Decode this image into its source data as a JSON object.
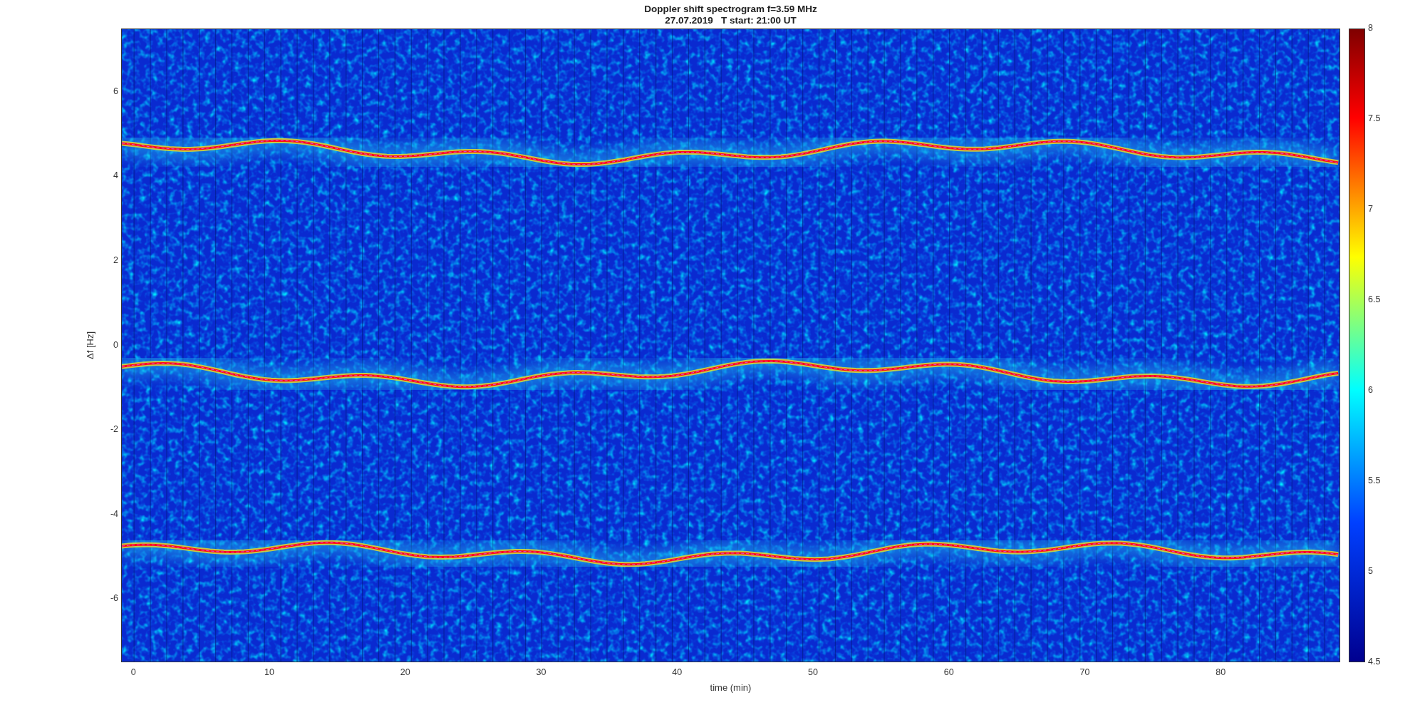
{
  "title": {
    "line_1": "Doppler shift spectrogram f=3.59 MHz",
    "line_2": "27.07.2019   T start: 21:00 UT"
  },
  "ylabel": "Δf [Hz]",
  "xlabel": "time (min)",
  "yticks": [
    "6",
    "4",
    "2",
    "0",
    "-2",
    "-4",
    "-6"
  ],
  "xticks": [
    "0",
    "10",
    "20",
    "30",
    "40",
    "50",
    "60",
    "70",
    "80"
  ],
  "colorbar_ticks": [
    "8",
    "7.5",
    "7",
    "6.5",
    "6",
    "5.5",
    "5",
    "4.5"
  ]
}
